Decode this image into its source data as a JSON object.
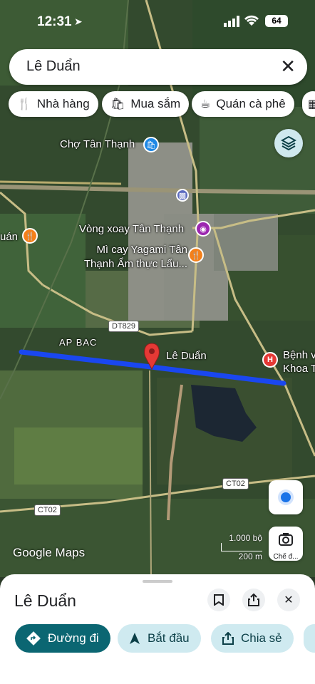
{
  "status": {
    "time": "12:31",
    "battery": "64"
  },
  "search": {
    "query": "Lê Duẩn"
  },
  "chips": [
    {
      "label": "Nhà hàng",
      "icon": "restaurant-icon"
    },
    {
      "label": "Mua sắm",
      "icon": "shopping-bag-icon"
    },
    {
      "label": "Quán cà phê",
      "icon": "coffee-icon"
    }
  ],
  "map": {
    "labels": {
      "market": "Chợ Tân Thạnh",
      "roundabout": "Vòng xoay Tân Thạnh",
      "restaurant": "Mì cay Yagami Tân Thạnh Ẩm thực Lẩu...",
      "ap_bac": "AP BAC",
      "pin": "Lê Duẩn",
      "hospital": "Bệnh v Khoa T",
      "left_edge": "uán"
    },
    "road_tags": [
      "DT829",
      "CT02",
      "CT02"
    ],
    "brand": "Google Maps",
    "scale": {
      "top": "1.000 bộ",
      "bottom": "200 m"
    },
    "lens_label": "Chế đ...",
    "colors": {
      "route": "#1a47f0",
      "pin": "#e53935",
      "restaurant_poi": "#f4801a",
      "shop_poi": "#1e88e5",
      "hospital_poi": "#e53935"
    }
  },
  "sheet": {
    "title": "Lê Duẩn",
    "actions": [
      {
        "label": "Đường đi"
      },
      {
        "label": "Bắt đầu"
      },
      {
        "label": "Chia sẻ"
      }
    ]
  }
}
